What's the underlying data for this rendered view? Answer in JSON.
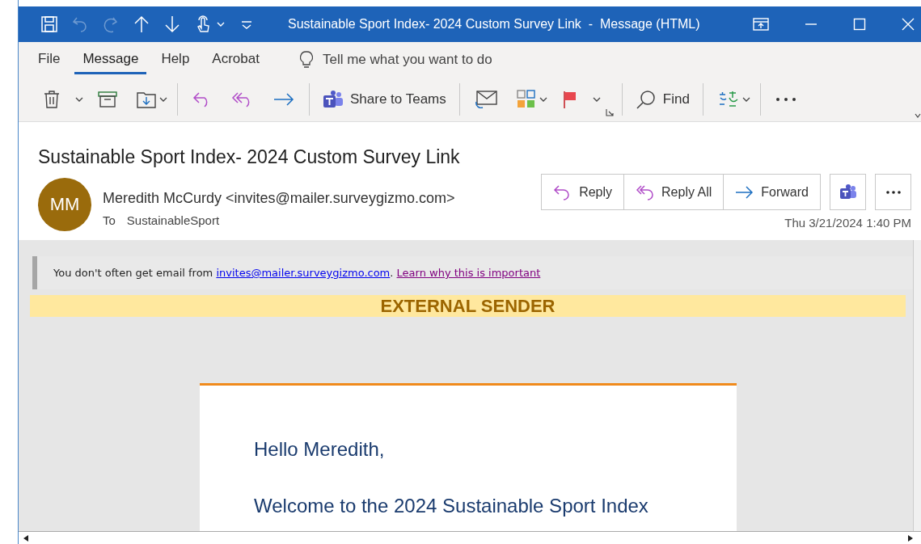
{
  "window": {
    "title": "Sustainable Sport Index- 2024 Custom Survey Link  -  Message (HTML)"
  },
  "quick_access": [
    {
      "kind": "save",
      "disabled": false
    },
    {
      "kind": "undo",
      "disabled": true
    },
    {
      "kind": "redo",
      "disabled": true
    },
    {
      "kind": "up",
      "disabled": false
    },
    {
      "kind": "down",
      "disabled": false
    },
    {
      "kind": "touch",
      "disabled": false
    },
    {
      "kind": "customize",
      "disabled": false
    }
  ],
  "menu_tabs": [
    {
      "label": "File",
      "selected": false
    },
    {
      "label": "Message",
      "selected": true
    },
    {
      "label": "Help",
      "selected": false
    },
    {
      "label": "Acrobat",
      "selected": false
    }
  ],
  "tell_me": {
    "placeholder": "Tell me what you want to do"
  },
  "toolbar": {
    "share_to_teams": "Share to Teams",
    "find": "Find"
  },
  "message": {
    "subject": "Sustainable Sport Index- 2024 Custom Survey Link",
    "avatar_initials": "MM",
    "sender": "Meredith McCurdy <invites@mailer.surveygizmo.com>",
    "to_label": "To",
    "to": "SustainableSport",
    "date": "Thu 3/21/2024 1:40 PM",
    "actions": [
      {
        "kind": "reply",
        "label": "Reply"
      },
      {
        "kind": "reply_all",
        "label": "Reply All"
      },
      {
        "kind": "forward",
        "label": "Forward"
      }
    ]
  },
  "body": {
    "notice": {
      "text": "You don't often get email from ",
      "link": "invites@mailer.surveygizmo.com",
      "after": ". ",
      "learn_link": "Learn why this is important"
    },
    "banner": "EXTERNAL SENDER",
    "greeting": "Hello Meredith,",
    "paragraph": "Welcome to the 2024 Sustainable Sport Index"
  }
}
